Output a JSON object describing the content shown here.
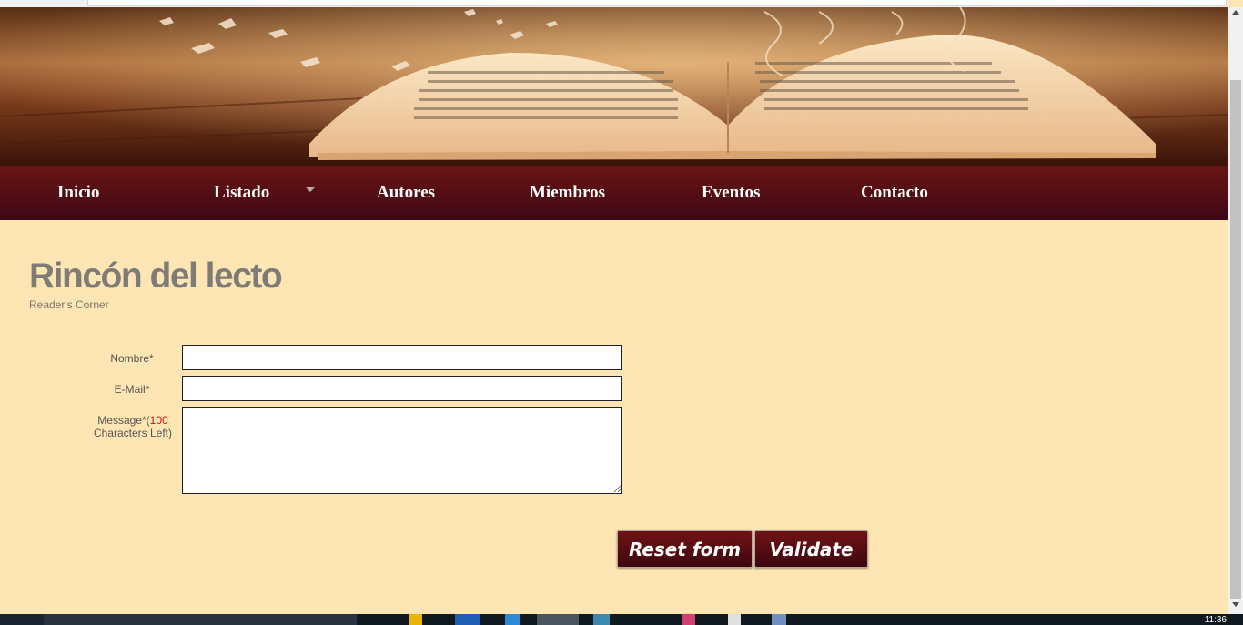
{
  "nav": {
    "items": [
      {
        "label": "Inicio"
      },
      {
        "label": "Listado"
      },
      {
        "label": "Autores"
      },
      {
        "label": "Miembros"
      },
      {
        "label": "Eventos"
      },
      {
        "label": "Contacto"
      }
    ]
  },
  "header": {
    "title": "Rincón del lecto",
    "subtitle": "Reader's Corner"
  },
  "form": {
    "name_label": "Nombre*",
    "email_label": "E-Mail*",
    "message_label_prefix": "Message*(",
    "message_count": "100",
    "message_label_suffix": "Characters Left)",
    "name_value": "",
    "email_value": "",
    "message_value": ""
  },
  "buttons": {
    "reset_label": "Reset form",
    "validate_label": "Validate"
  },
  "taskbar": {
    "clock": "11:36"
  },
  "colors": {
    "page_background": "#fde6b4",
    "nav_background": "#5a0f15",
    "title_text": "#7f7b76",
    "button_background": "#5a0d12",
    "count_highlight": "#cc1111"
  }
}
